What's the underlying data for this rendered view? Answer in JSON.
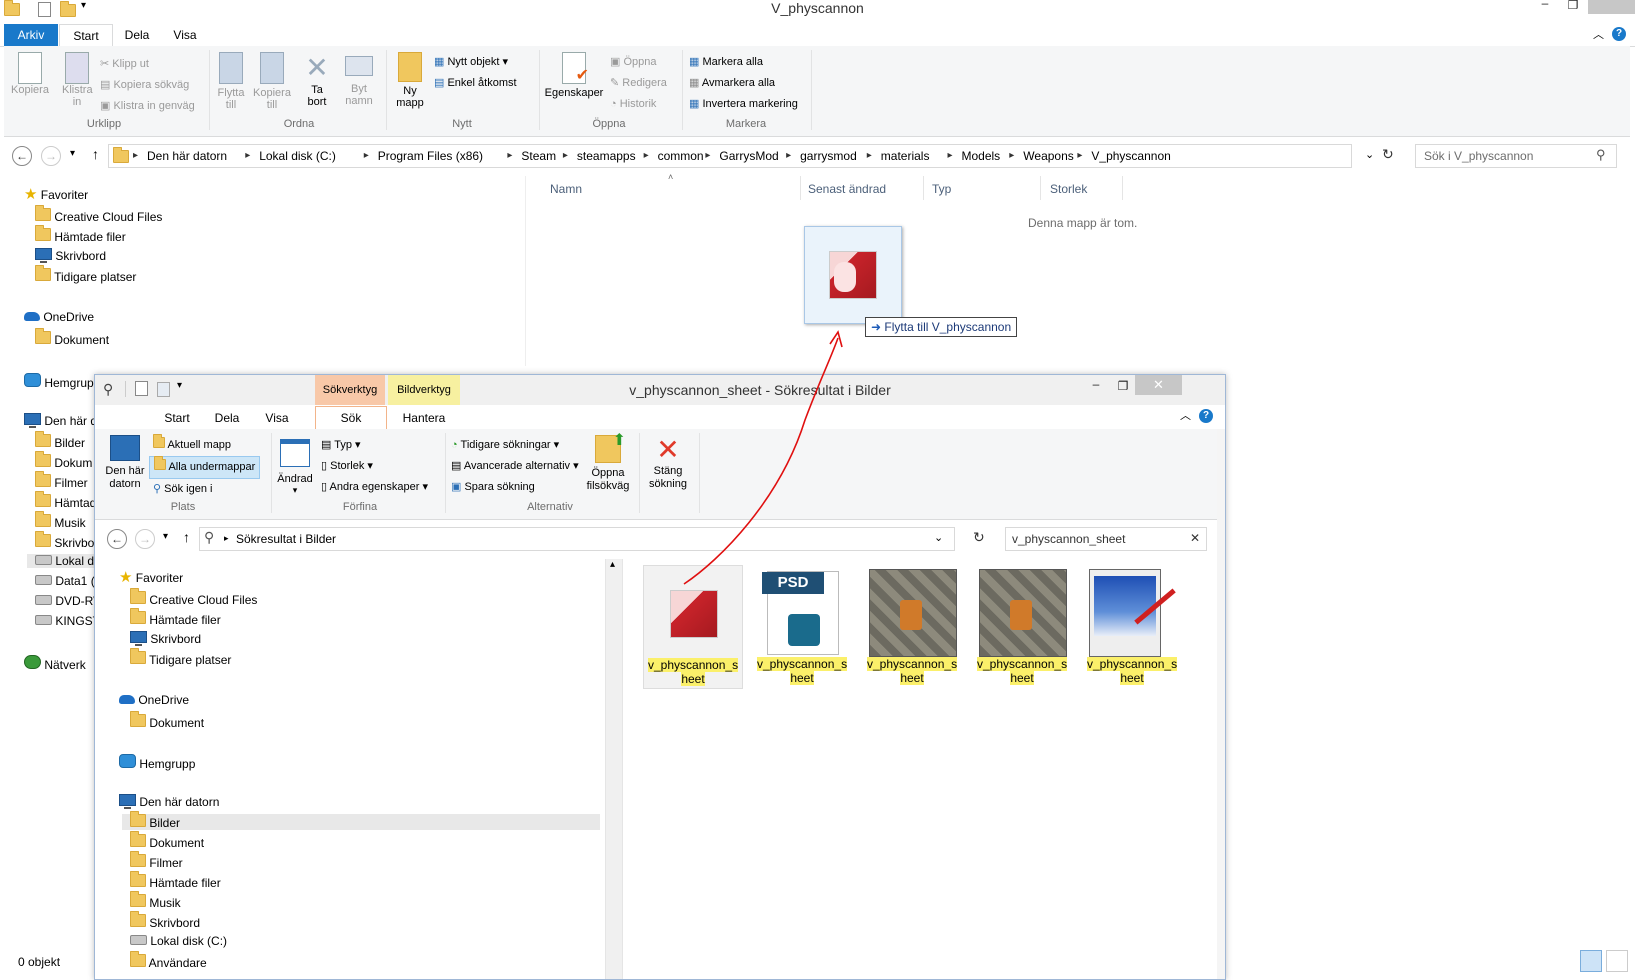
{
  "back_window": {
    "title": "V_physcannon",
    "tabs": {
      "arkiv": "Arkiv",
      "start": "Start",
      "dela": "Dela",
      "visa": "Visa"
    },
    "ribbon": {
      "kopiera": "Kopiera",
      "klistra_in": "Klistra in",
      "klipp_ut": "Klipp ut",
      "kopiera_sokvag": "Kopiera sökväg",
      "klistra_genvag": "Klistra in genväg",
      "group_urklipp": "Urklipp",
      "flytta_till": "Flytta till",
      "kopiera_till": "Kopiera till",
      "ta_bort": "Ta bort",
      "byt_namn": "Byt namn",
      "group_ordna": "Ordna",
      "ny_mapp": "Ny mapp",
      "nytt_objekt": "Nytt objekt",
      "enkel_atkomst": "Enkel åtkomst",
      "group_nytt": "Nytt",
      "egenskaper": "Egenskaper",
      "oppna": "Öppna",
      "redigera": "Redigera",
      "historik": "Historik",
      "group_oppna": "Öppna",
      "markera_alla": "Markera alla",
      "avmarkera_alla": "Avmarkera alla",
      "invertera": "Invertera markering",
      "group_markera": "Markera"
    },
    "address": [
      "Den här datorn",
      "Lokal disk (C:)",
      "Program Files (x86)",
      "Steam",
      "steamapps",
      "common",
      "GarrysMod",
      "garrysmod",
      "materials",
      "Models",
      "Weapons",
      "V_physcannon"
    ],
    "search_placeholder": "Sök i V_physcannon",
    "columns": {
      "name": "Namn",
      "date": "Senast ändrad",
      "type": "Typ",
      "size": "Storlek"
    },
    "empty_msg": "Denna mapp är tom.",
    "drag_tooltip": "Flytta till V_physcannon",
    "status": "0 objekt",
    "nav": {
      "favoriter": "Favoriter",
      "fav_items": [
        "Creative Cloud Files",
        "Hämtade filer",
        "Skrivbord",
        "Tidigare platser"
      ],
      "onedrive": "OneDrive",
      "onedrive_items": [
        "Dokument"
      ],
      "hemgrupp": "Hemgrup",
      "den_har_datorn": "Den här d",
      "pc_items": [
        "Bilder",
        "Dokum",
        "Filmer",
        "Hämtad",
        "Musik",
        "Skrivbo",
        "Lokal d",
        "Data1 (",
        "DVD-RV",
        "KINGST"
      ],
      "natverk": "Nätverk"
    }
  },
  "front_window": {
    "title": "v_physcannon_sheet - Sökresultat i Bilder",
    "context_tabs": {
      "sokverktyg": "Sökverktyg",
      "bildverktyg": "Bildverktyg"
    },
    "tabs": {
      "start": "Start",
      "dela": "Dela",
      "visa": "Visa",
      "sok": "Sök",
      "hantera": "Hantera"
    },
    "ribbon": {
      "den_har_datorn": "Den här datorn",
      "aktuell_mapp": "Aktuell mapp",
      "alla_undermappar": "Alla undermappar",
      "sok_igen_i": "Sök igen i",
      "group_plats": "Plats",
      "andrad": "Ändrad",
      "typ": "Typ",
      "storlek": "Storlek",
      "andra_egenskaper": "Andra egenskaper",
      "group_forfina": "Förfina",
      "tidigare_sokningar": "Tidigare sökningar",
      "avancerade": "Avancerade alternativ",
      "spara_sokning": "Spara sökning",
      "group_alternativ": "Alternativ",
      "oppna_filsokvag": "Öppna filsökväg",
      "stang_sokning": "Stäng sökning"
    },
    "address": "Sökresultat i Bilder",
    "search_value": "v_physcannon_sheet",
    "nav": {
      "favoriter": "Favoriter",
      "fav_items": [
        "Creative Cloud Files",
        "Hämtade filer",
        "Skrivbord",
        "Tidigare platser"
      ],
      "onedrive": "OneDrive",
      "onedrive_items": [
        "Dokument"
      ],
      "hemgrupp": "Hemgrupp",
      "den_har_datorn": "Den här datorn",
      "pc_items": [
        "Bilder",
        "Dokument",
        "Filmer",
        "Hämtade filer",
        "Musik",
        "Skrivbord",
        "Lokal disk (C:)",
        "Användare"
      ]
    },
    "files": [
      {
        "line1": "v_physcannon_s",
        "line2": "heet",
        "kind": "anime"
      },
      {
        "line1": "v_physcannon_s",
        "line2": "heet",
        "kind": "psd",
        "badge": "PSD"
      },
      {
        "line1": "v_physcannon_s",
        "line2": "heet",
        "kind": "texture"
      },
      {
        "line1": "v_physcannon_s",
        "line2": "heet",
        "kind": "texture"
      },
      {
        "line1": "v_physcannon_s",
        "line2": "heet",
        "kind": "paint"
      }
    ]
  },
  "colors": {
    "accent": "#1979ca",
    "context_sok": "#f8c8a8",
    "context_bild": "#f7f0a0",
    "highlight": "#fbf06a",
    "drag_line": "#e01010"
  }
}
